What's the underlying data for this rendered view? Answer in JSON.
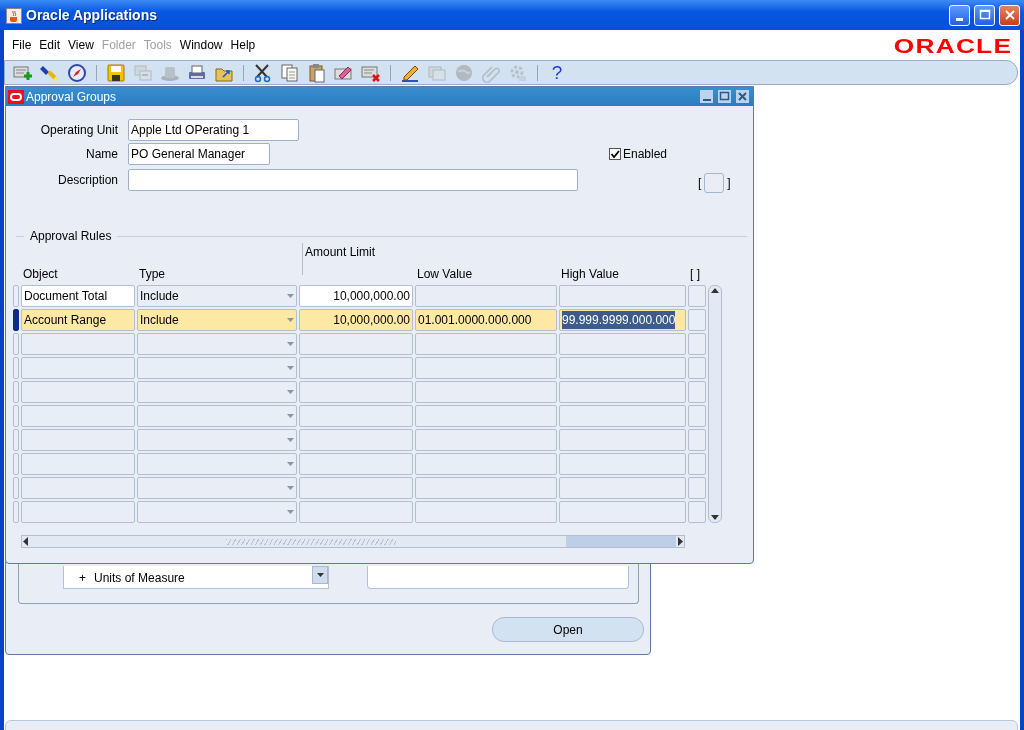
{
  "window": {
    "title": "Oracle Applications"
  },
  "menu": [
    {
      "label": "File",
      "disabled": false
    },
    {
      "label": "Edit",
      "disabled": false
    },
    {
      "label": "View",
      "disabled": false
    },
    {
      "label": "Folder",
      "disabled": true
    },
    {
      "label": "Tools",
      "disabled": true
    },
    {
      "label": "Window",
      "disabled": false
    },
    {
      "label": "Help",
      "disabled": false
    }
  ],
  "brand": "ORACLE",
  "toolbar": [
    {
      "kind": "button",
      "disabled": false
    },
    {
      "kind": "button",
      "disabled": false
    },
    {
      "kind": "button",
      "disabled": false
    },
    {
      "kind": "separator"
    },
    {
      "kind": "button",
      "disabled": false
    },
    {
      "kind": "button",
      "disabled": true
    },
    {
      "kind": "button",
      "disabled": true
    },
    {
      "kind": "button",
      "disabled": false
    },
    {
      "kind": "button",
      "disabled": false
    },
    {
      "kind": "separator"
    },
    {
      "kind": "button",
      "disabled": false
    },
    {
      "kind": "button",
      "disabled": false
    },
    {
      "kind": "button",
      "disabled": false
    },
    {
      "kind": "button",
      "disabled": false
    },
    {
      "kind": "button",
      "disabled": false
    },
    {
      "kind": "separator"
    },
    {
      "kind": "button",
      "disabled": false
    },
    {
      "kind": "button",
      "disabled": true
    },
    {
      "kind": "button",
      "disabled": true
    },
    {
      "kind": "button",
      "disabled": true
    },
    {
      "kind": "button",
      "disabled": true
    },
    {
      "kind": "separator"
    },
    {
      "kind": "glyph",
      "label": "?",
      "disabled": false
    }
  ],
  "background_window": {
    "list_items": [
      {
        "expander": "+",
        "label": "Units of Measure"
      }
    ],
    "button": "Open"
  },
  "form_window": {
    "title": "Approval Groups",
    "fields": [
      {
        "label": "Operating Unit",
        "value": "Apple Ltd OPerating 1"
      },
      {
        "label": "Name",
        "value": "PO General Manager"
      },
      {
        "label": "Description"
      }
    ],
    "enabled": {
      "label": "Enabled",
      "checked": true
    },
    "flex_brackets": [
      "[",
      "]"
    ],
    "section": "Approval Rules",
    "columns": [
      {
        "label": "Object",
        "kind": "text"
      },
      {
        "label": "Type",
        "kind": "dropdown"
      },
      {
        "label": "Amount Limit",
        "kind": "number"
      },
      {
        "label": "Low Value",
        "kind": "text"
      },
      {
        "label": "High Value",
        "kind": "text"
      },
      {
        "label": "[ ]",
        "kind": "flex"
      }
    ],
    "rows": [
      {
        "cells": [
          {
            "text": "Document Total",
            "text_selected": false
          },
          {
            "text": "Include",
            "text_selected": false
          },
          {
            "text": "10,000,000.00",
            "text_selected": false
          }
        ],
        "selected": false
      },
      {
        "cells": [
          {
            "text": "Account Range",
            "text_selected": false
          },
          {
            "text": "Include",
            "text_selected": false
          },
          {
            "text": "10,000,000.00",
            "text_selected": false
          },
          {
            "text": "01.001.0000.000.000",
            "text_selected": false
          },
          {
            "text": "99.999.9999.000.000",
            "text_selected": true
          }
        ],
        "selected": true
      },
      {
        "selected": false
      },
      {
        "selected": false
      },
      {
        "selected": false
      },
      {
        "selected": false
      },
      {
        "selected": false
      },
      {
        "selected": false
      },
      {
        "selected": false
      },
      {
        "selected": false
      }
    ]
  }
}
